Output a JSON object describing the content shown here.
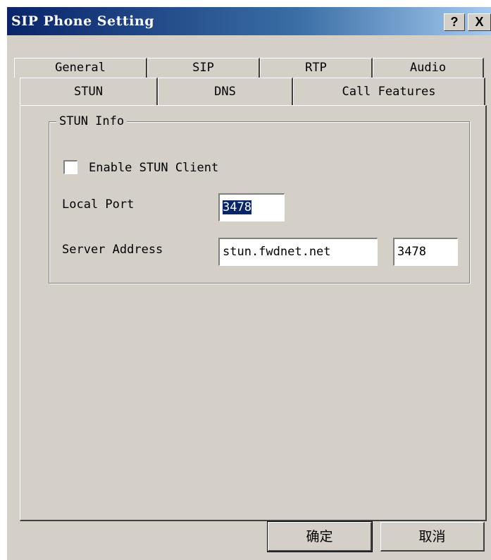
{
  "window": {
    "title": "SIP Phone Setting",
    "help_label": "?",
    "close_label": "X"
  },
  "tabs": {
    "row1": [
      "General",
      "SIP",
      "RTP",
      "Audio"
    ],
    "row2": [
      "STUN",
      "DNS",
      "Call Features"
    ],
    "active": "STUN"
  },
  "stun": {
    "group_title": "STUN Info",
    "enable_label": "Enable STUN Client",
    "enable_checked": false,
    "local_port_label": "Local Port",
    "local_port_value": "3478",
    "server_address_label": "Server Address",
    "server_address_value": "stun.fwdnet.net",
    "server_port_value": "3478"
  },
  "buttons": {
    "ok_label": "确定",
    "cancel_label": "取消"
  }
}
